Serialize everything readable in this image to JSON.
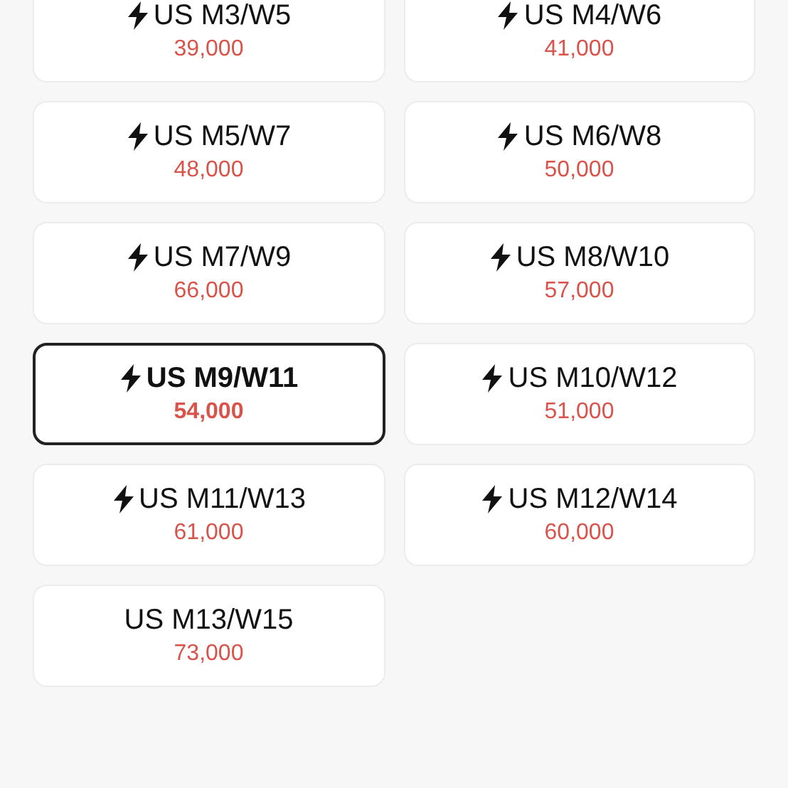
{
  "sizes": [
    {
      "label": "US M3/W5",
      "price": "39,000",
      "fast": true,
      "selected": false
    },
    {
      "label": "US M4/W6",
      "price": "41,000",
      "fast": true,
      "selected": false
    },
    {
      "label": "US M5/W7",
      "price": "48,000",
      "fast": true,
      "selected": false
    },
    {
      "label": "US M6/W8",
      "price": "50,000",
      "fast": true,
      "selected": false
    },
    {
      "label": "US M7/W9",
      "price": "66,000",
      "fast": true,
      "selected": false
    },
    {
      "label": "US M8/W10",
      "price": "57,000",
      "fast": true,
      "selected": false
    },
    {
      "label": "US M9/W11",
      "price": "54,000",
      "fast": true,
      "selected": true
    },
    {
      "label": "US M10/W12",
      "price": "51,000",
      "fast": true,
      "selected": false
    },
    {
      "label": "US M11/W13",
      "price": "61,000",
      "fast": true,
      "selected": false
    },
    {
      "label": "US M12/W14",
      "price": "60,000",
      "fast": true,
      "selected": false
    },
    {
      "label": "US M13/W15",
      "price": "73,000",
      "fast": false,
      "selected": false
    }
  ]
}
